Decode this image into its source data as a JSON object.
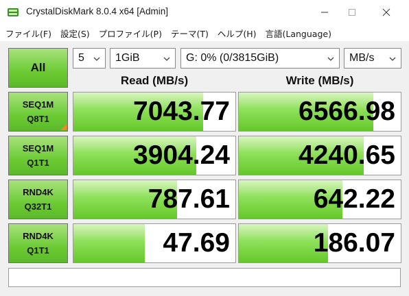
{
  "window": {
    "title": "CrystalDiskMark 8.0.4 x64 [Admin]"
  },
  "menu": [
    "ファイル(F)",
    "設定(S)",
    "プロファイル(P)",
    "テーマ(T)",
    "ヘルプ(H)",
    "言語(Language)"
  ],
  "controls": {
    "all_label": "All",
    "count": "5",
    "size": "1GiB",
    "drive": "G: 0% (0/3815GiB)",
    "unit": "MB/s"
  },
  "headers": {
    "read": "Read (MB/s)",
    "write": "Write (MB/s)"
  },
  "tests": [
    {
      "line1": "SEQ1M",
      "line2": "Q8T1",
      "read": "7043.77",
      "write": "6566.98",
      "read_fill": 0.8,
      "write_fill": 0.83
    },
    {
      "line1": "SEQ1M",
      "line2": "Q1T1",
      "read": "3904.24",
      "write": "4240.65",
      "read_fill": 0.76,
      "write_fill": 0.77
    },
    {
      "line1": "RND4K",
      "line2": "Q32T1",
      "read": "787.61",
      "write": "642.22",
      "read_fill": 0.64,
      "write_fill": 0.64
    },
    {
      "line1": "RND4K",
      "line2": "Q1T1",
      "read": "47.69",
      "write": "186.07",
      "read_fill": 0.44,
      "write_fill": 0.55
    }
  ],
  "comment": "",
  "colors": {
    "accent_green": "#6ccb34",
    "fill_green": "#8ee05a",
    "marker_orange": "#f08a1a"
  }
}
